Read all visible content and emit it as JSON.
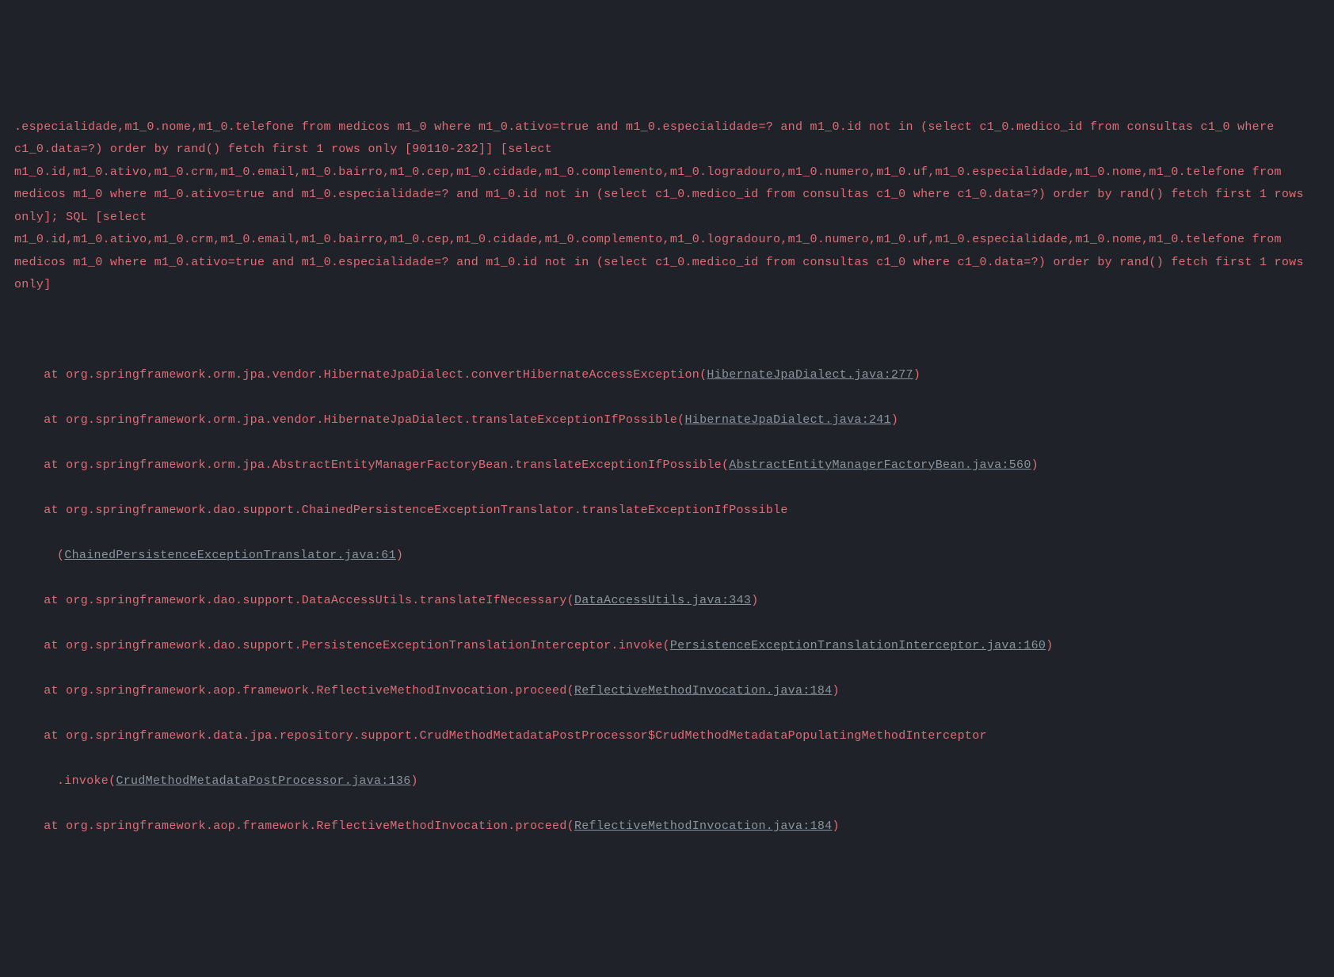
{
  "error": {
    "sqlMessage": ".especialidade,m1_0.nome,m1_0.telefone from medicos m1_0 where m1_0.ativo=true and m1_0.especialidade=? and m1_0.id not in (select c1_0.medico_id from consultas c1_0 where c1_0.data=?) order by rand() fetch first 1 rows only [90110-232]] [select m1_0.id,m1_0.ativo,m1_0.crm,m1_0.email,m1_0.bairro,m1_0.cep,m1_0.cidade,m1_0.complemento,m1_0.logradouro,m1_0.numero,m1_0.uf,m1_0.especialidade,m1_0.nome,m1_0.telefone from medicos m1_0 where m1_0.ativo=true and m1_0.especialidade=? and m1_0.id not in (select c1_0.medico_id from consultas c1_0 where c1_0.data=?) order by rand() fetch first 1 rows only]; SQL [select m1_0.id,m1_0.ativo,m1_0.crm,m1_0.email,m1_0.bairro,m1_0.cep,m1_0.cidade,m1_0.complemento,m1_0.logradouro,m1_0.numero,m1_0.uf,m1_0.especialidade,m1_0.nome,m1_0.telefone from medicos m1_0 where m1_0.ativo=true and m1_0.especialidade=? and m1_0.id not in (select c1_0.medico_id from consultas c1_0 where c1_0.data=?) order by rand() fetch first 1 rows only]"
  },
  "stack": [
    {
      "at": "at ",
      "method": "org.springframework.orm.jpa.vendor.HibernateJpaDialect.convertHibernateAccessException",
      "link": "HibernateJpaDialect.java:277"
    },
    {
      "at": "at ",
      "method": "org.springframework.orm.jpa.vendor.HibernateJpaDialect.translateExceptionIfPossible",
      "link": "HibernateJpaDialect.java:241"
    },
    {
      "at": "at ",
      "method": "org.springframework.orm.jpa.AbstractEntityManagerFactoryBean.translateExceptionIfPossible",
      "link": "AbstractEntityManagerFactoryBean.java:560"
    },
    {
      "at": "at ",
      "method": "org.springframework.dao.support.ChainedPersistenceExceptionTranslator.translateExceptionIfPossible",
      "link": "ChainedPersistenceExceptionTranslator.java:61",
      "wrap": true
    },
    {
      "at": "at ",
      "method": "org.springframework.dao.support.DataAccessUtils.translateIfNecessary",
      "link": "DataAccessUtils.java:343"
    },
    {
      "at": "at ",
      "method": "org.springframework.dao.support.PersistenceExceptionTranslationInterceptor.invoke",
      "link": "PersistenceExceptionTranslationInterceptor.java:160",
      "wraplink": true
    },
    {
      "at": "at ",
      "method": "org.springframework.aop.framework.ReflectiveMethodInvocation.proceed",
      "link": "ReflectiveMethodInvocation.java:184"
    },
    {
      "at": "at ",
      "method": "org.springframework.data.jpa.repository.support.CrudMethodMetadataPostProcessor$CrudMethodMetadataPopulatingMethodInterceptor.invoke",
      "link": "CrudMethodMetadataPostProcessor.java:136",
      "wraplink": true,
      "methodwrap": ".invoke"
    },
    {
      "at": "at ",
      "method": "org.springframework.aop.framework.ReflectiveMethodInvocation.proceed",
      "link": "ReflectiveMethodInvocation.java:184"
    }
  ]
}
